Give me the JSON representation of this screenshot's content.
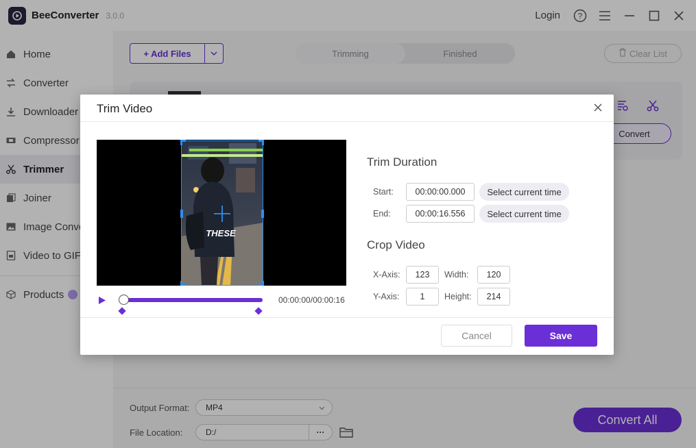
{
  "app": {
    "name": "BeeConverter",
    "version": "3.0.0",
    "login_label": "Login"
  },
  "sidebar": {
    "items": [
      {
        "label": "Home",
        "icon": "home-icon"
      },
      {
        "label": "Converter",
        "icon": "convert-icon"
      },
      {
        "label": "Downloader",
        "icon": "download-icon"
      },
      {
        "label": "Compressor",
        "icon": "compress-icon"
      },
      {
        "label": "Trimmer",
        "icon": "scissors-icon",
        "active": true
      },
      {
        "label": "Joiner",
        "icon": "joiner-icon"
      },
      {
        "label": "Image Converter",
        "icon": "image-icon"
      },
      {
        "label": "Video to GIF",
        "icon": "gif-icon"
      }
    ],
    "products_label": "Products"
  },
  "toolbar": {
    "add_files_label": "+ Add Files",
    "clear_list_label": "Clear List"
  },
  "tabs": [
    {
      "label": "Trimming",
      "active": true
    },
    {
      "label": "Finished",
      "active": false
    }
  ],
  "file_card": {
    "convert_label": "Convert"
  },
  "bottom": {
    "output_format_label": "Output Format:",
    "output_format_value": "MP4",
    "file_location_label": "File Location:",
    "file_location_value": "D:/",
    "browse_label": "···",
    "convert_all_label": "Convert All"
  },
  "modal": {
    "title": "Trim Video",
    "video_caption": "THESE",
    "time_current": "00:00:00",
    "time_total": "00:00:16",
    "playback_position": 0.0,
    "trim_title": "Trim Duration",
    "start_label": "Start:",
    "start_value": "00:00:00.000",
    "end_label": "End:",
    "end_value": "00:00:16.556",
    "select_current_label": "Select current time",
    "crop_title": "Crop Video",
    "x_label": "X-Axis:",
    "x_value": "123",
    "y_label": "Y-Axis:",
    "y_value": "1",
    "width_label": "Width:",
    "width_value": "120",
    "height_label": "Height:",
    "height_value": "214",
    "cancel_label": "Cancel",
    "save_label": "Save"
  },
  "colors": {
    "accent": "#6a2fd6",
    "crop": "#2b8ff0"
  }
}
